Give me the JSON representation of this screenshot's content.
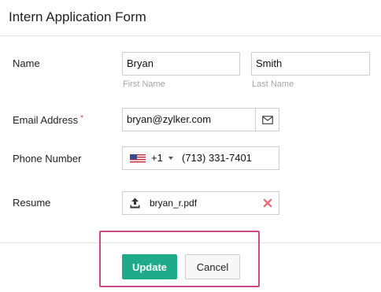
{
  "form": {
    "title": "Intern Application Form",
    "name": {
      "label": "Name",
      "first_value": "Bryan",
      "first_sublabel": "First Name",
      "last_value": "Smith",
      "last_sublabel": "Last Name"
    },
    "email": {
      "label": "Email Address",
      "required_mark": "*",
      "value": "bryan@zylker.com",
      "icon": "envelope-icon"
    },
    "phone": {
      "label": "Phone Number",
      "country_flag": "us-flag-icon",
      "dial_code": "+1",
      "value": "(713) 331-7401"
    },
    "resume": {
      "label": "Resume",
      "file_name": "bryan_r.pdf",
      "upload_icon": "upload-icon",
      "remove_icon": "close-icon"
    }
  },
  "actions": {
    "update_label": "Update",
    "cancel_label": "Cancel"
  },
  "colors": {
    "primary": "#1fab8a",
    "highlight": "#c94a86",
    "required": "#e0374b",
    "remove": "#e8707a"
  }
}
